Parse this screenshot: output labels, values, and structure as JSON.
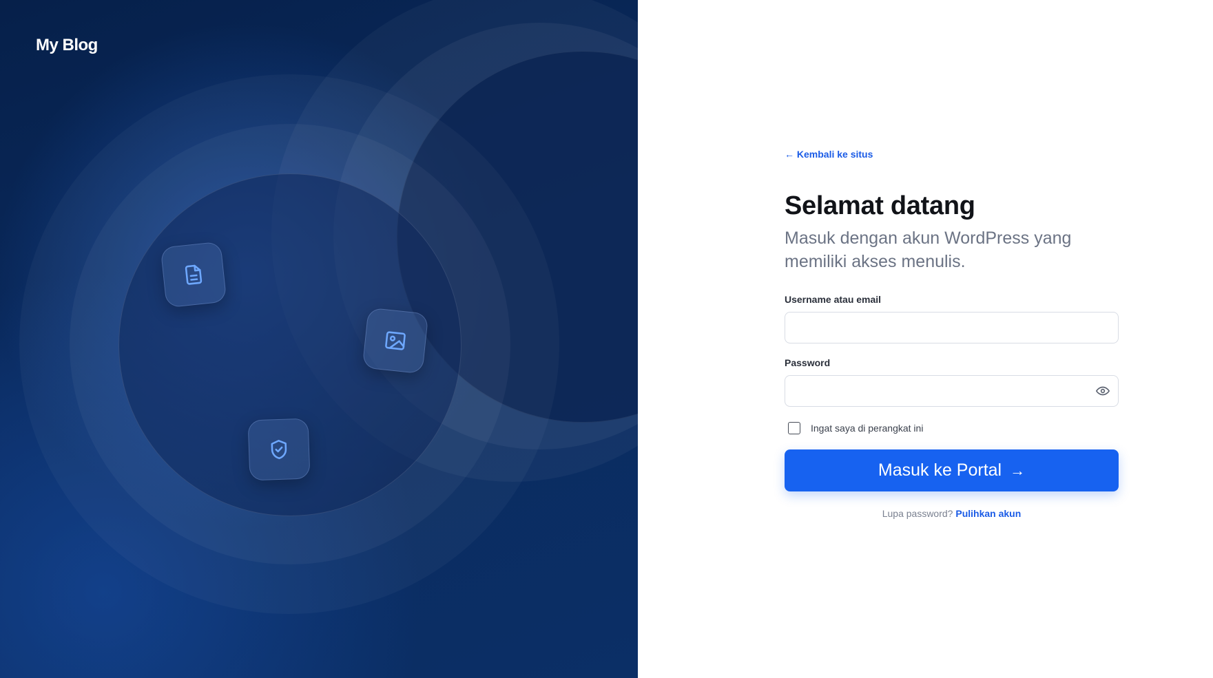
{
  "brand": {
    "name": "My Blog"
  },
  "illustration": {
    "icons": [
      "document-icon",
      "image-icon",
      "shield-check-icon"
    ]
  },
  "form": {
    "back_link": "← Kembali ke situs",
    "title": "Selamat datang",
    "subtitle": "Masuk dengan akun WordPress yang memiliki akses menulis.",
    "username_label": "Username atau email",
    "username_value": "",
    "password_label": "Password",
    "password_value": "",
    "remember_label": "Ingat saya di perangkat ini",
    "remember_checked": false,
    "submit_label": "Masuk ke Portal",
    "submit_arrow": "→",
    "forgot_text": "Lupa password?",
    "recover_link": "Pulihkan akun"
  },
  "colors": {
    "primary": "#1762f0",
    "link": "#1a5be6",
    "panel_dark": "#0a2a5e"
  }
}
